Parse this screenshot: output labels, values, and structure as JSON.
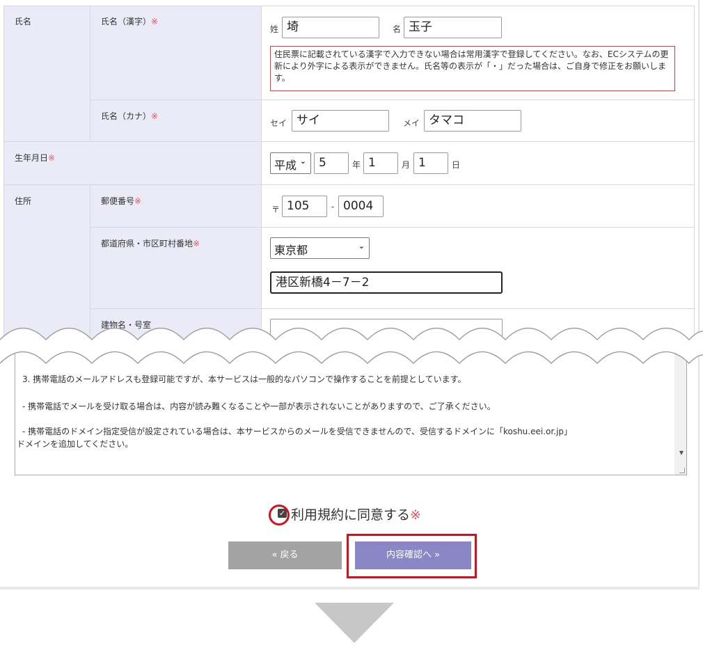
{
  "rows": {
    "name": {
      "label": "氏名",
      "kanji": {
        "label": "氏名（漢字）",
        "required": "※",
        "sei_label": "姓",
        "sei_value": "埼",
        "mei_label": "名",
        "mei_value": "玉子"
      },
      "notice": "住民票に記載されている漢字で入力できない場合は常用漢字で登録してください。なお、ECシステムの更新により外字による表示ができません。氏名等の表示が「・」だった場合は、ご自身で修正をお願いします。",
      "kana": {
        "label": "氏名（カナ）",
        "required": "※",
        "sei_label": "セイ",
        "sei_value": "サイ",
        "mei_label": "メイ",
        "mei_value": "タマコ"
      }
    },
    "birth": {
      "label": "生年月日",
      "required": "※",
      "era": "平成",
      "year": "5",
      "year_label": "年",
      "month": "1",
      "month_label": "月",
      "day": "1",
      "day_label": "日"
    },
    "address": {
      "label": "住所",
      "postal": {
        "label": "郵便番号",
        "required": "※",
        "mark": "〒",
        "first": "105",
        "dash": "-",
        "second": "0004"
      },
      "pref": {
        "label": "都道府県・市区町村番地",
        "required": "※",
        "prefecture": "東京都",
        "street": "港区新橋4－7－2"
      },
      "building": {
        "label": "建物名・号室",
        "value": ""
      }
    }
  },
  "terms": {
    "line1": "3.  携帯電話のメールアドレスも登録可能ですが、本サービスは一般的なパソコンで操作することを前提としています。",
    "line2": "  -  携帯電話でメールを受け取る場合は、内容が読み難くなることや一部が表示されないことがありますので、ご了承ください。",
    "line3a": "  -  携帯電話のドメイン指定受信が設定されている場合は、本サービスからのメールを受信できませんので、受信するドメインに「koshu.eei.or.jp」",
    "line3b": "ドメインを追加してください。"
  },
  "agree": {
    "label": "利用規約に同意する",
    "required": "※",
    "checked": true
  },
  "buttons": {
    "back": "«  戻る",
    "next": "内容確認へ  »"
  },
  "colors": {
    "label_bg": "#ebebf8",
    "required": "#e8545c",
    "highlight": "#d0121b",
    "next_button": "#8b86c6",
    "back_button": "#a3a3a3"
  }
}
